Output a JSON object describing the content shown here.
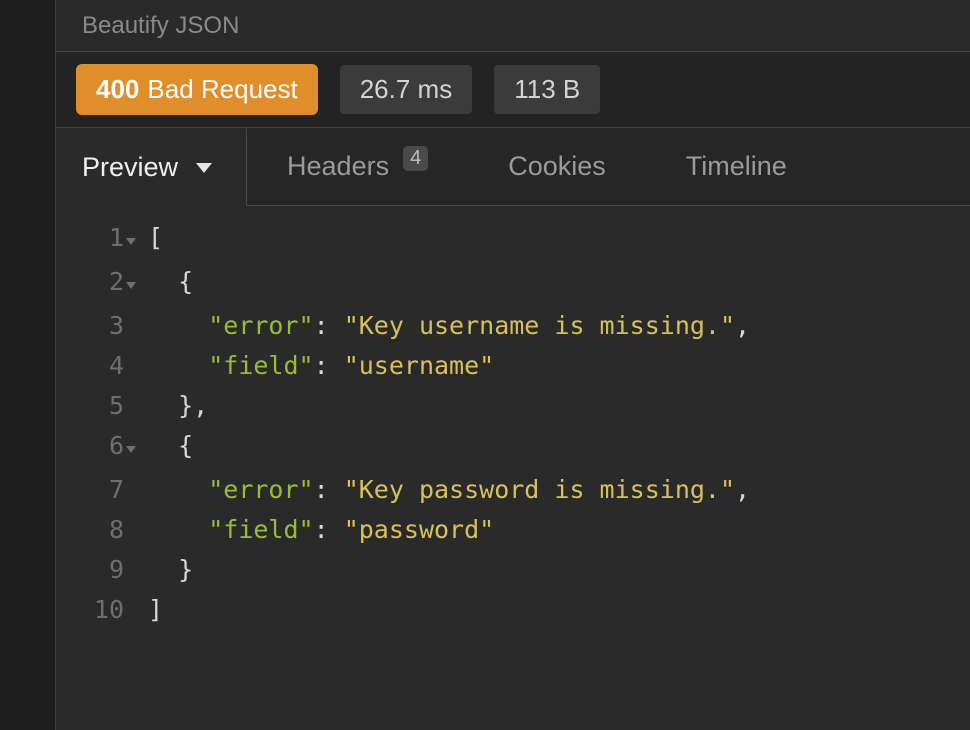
{
  "header": {
    "title": "Beautify JSON"
  },
  "status": {
    "code": "400",
    "text": "Bad Request",
    "elapsed": "26.7 ms",
    "size": "113 B",
    "badge_color": "#e08e2b"
  },
  "tabs": {
    "active": "Preview",
    "items": [
      {
        "label": "Preview",
        "active": true,
        "badge": null
      },
      {
        "label": "Headers",
        "active": false,
        "badge": "4"
      },
      {
        "label": "Cookies",
        "active": false,
        "badge": null
      },
      {
        "label": "Timeline",
        "active": false,
        "badge": null
      }
    ]
  },
  "response_body": [
    {
      "error": "Key username is missing.",
      "field": "username"
    },
    {
      "error": "Key password is missing.",
      "field": "password"
    }
  ],
  "code_lines": {
    "l1": "[",
    "l2_indent": "  ",
    "l2_brace": "{",
    "l3_indent": "    ",
    "l3_key": "\"error\"",
    "l3_sep": ": ",
    "l3_val": "\"Key username is missing.\"",
    "l3_end": ",",
    "l4_indent": "    ",
    "l4_key": "\"field\"",
    "l4_sep": ": ",
    "l4_val": "\"username\"",
    "l5": "  },",
    "l6_indent": "  ",
    "l6_brace": "{",
    "l7_indent": "    ",
    "l7_key": "\"error\"",
    "l7_sep": ": ",
    "l7_val": "\"Key password is missing.\"",
    "l7_end": ",",
    "l8_indent": "    ",
    "l8_key": "\"field\"",
    "l8_sep": ": ",
    "l8_val": "\"password\"",
    "l9": "  }",
    "l10": "]"
  },
  "line_numbers": {
    "n1": "1",
    "n2": "2",
    "n3": "3",
    "n4": "4",
    "n5": "5",
    "n6": "6",
    "n7": "7",
    "n8": "8",
    "n9": "9",
    "n10": "10"
  }
}
